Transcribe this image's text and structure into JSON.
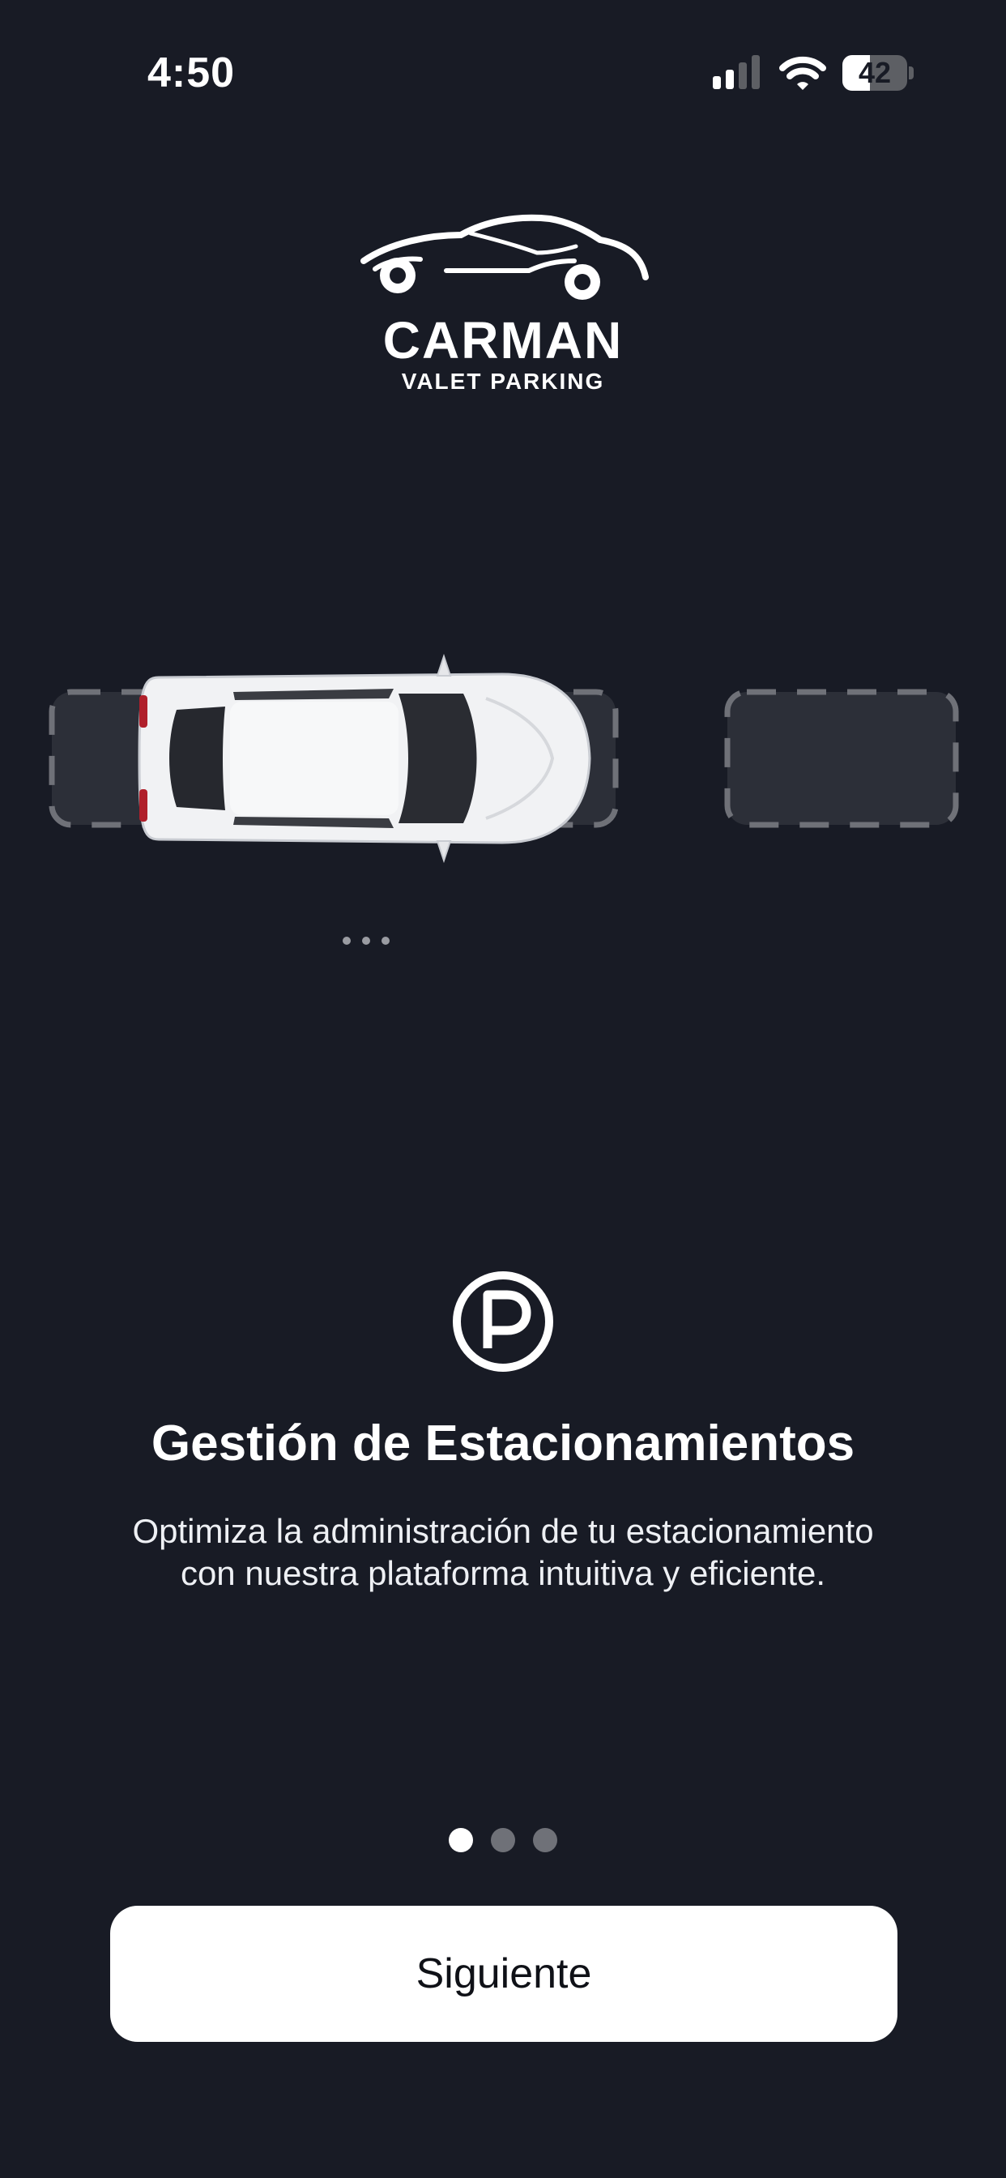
{
  "status_bar": {
    "time": "4:50",
    "battery_level": "42",
    "icons": [
      "cellular-signal-icon",
      "wifi-icon",
      "battery-icon"
    ]
  },
  "logo": {
    "brand": "CARMAN",
    "tagline": "VALET PARKING",
    "icon": "car-silhouette-icon"
  },
  "illustration": {
    "icon": "car-top-view-icon",
    "spots": [
      "parking-spot-left",
      "parking-spot-right"
    ],
    "indicator_icon": "more-dots-icon"
  },
  "feature": {
    "icon": "parking-p-icon",
    "title": "Gestión de Estacionamientos",
    "description_line1": "Optimiza la administración de tu estacionamiento",
    "description_line2": "con nuestra plataforma intuitiva y eficiente."
  },
  "pager": {
    "total": 3,
    "current": 1
  },
  "actions": {
    "next_label": "Siguiente"
  },
  "colors": {
    "background": "#181b25",
    "spot_fill": "#2c2f38",
    "spot_dash": "#6f7178",
    "button_bg": "#ffffff",
    "text": "#ffffff",
    "inactive_dot": "#6f7178"
  }
}
